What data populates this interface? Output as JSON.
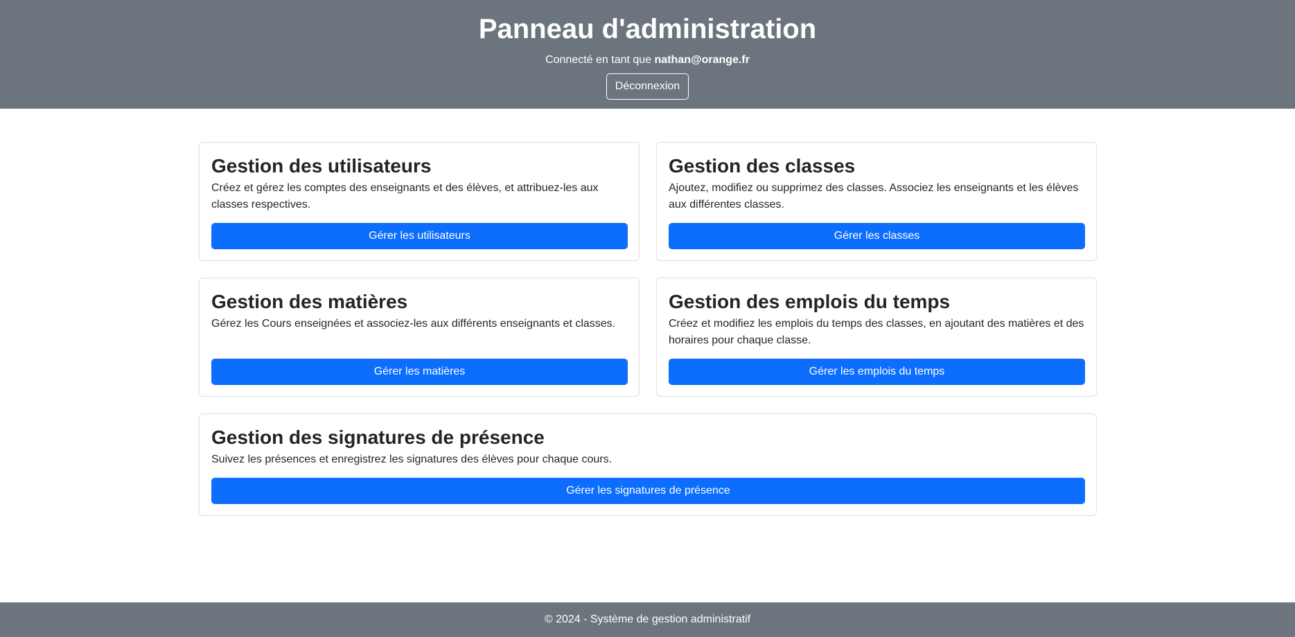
{
  "header": {
    "title": "Panneau d'administration",
    "connected_prefix": "Connecté en tant que ",
    "user_email": "nathan@orange.fr",
    "logout_label": "Déconnexion"
  },
  "cards": [
    {
      "title": "Gestion des utilisateurs",
      "description": "Créez et gérez les comptes des enseignants et des élèves, et attribuez-les aux classes respectives.",
      "button": "Gérer les utilisateurs"
    },
    {
      "title": "Gestion des classes",
      "description": "Ajoutez, modifiez ou supprimez des classes. Associez les enseignants et les élèves aux différentes classes.",
      "button": "Gérer les classes"
    },
    {
      "title": "Gestion des matières",
      "description": "Gérez les Cours enseignées et associez-les aux différents enseignants et classes.",
      "button": "Gérer les matières"
    },
    {
      "title": "Gestion des emplois du temps",
      "description": "Créez et modifiez les emplois du temps des classes, en ajoutant des matières et des horaires pour chaque classe.",
      "button": "Gérer les emplois du temps"
    },
    {
      "title": "Gestion des signatures de présence",
      "description": "Suivez les présences et enregistrez les signatures des élèves pour chaque cours.",
      "button": "Gérer les signatures de présence"
    }
  ],
  "footer": {
    "text": "© 2024 - Système de gestion administratif"
  },
  "colors": {
    "header_bg": "#6c757d",
    "primary": "#0d6efd",
    "text": "#212529"
  }
}
